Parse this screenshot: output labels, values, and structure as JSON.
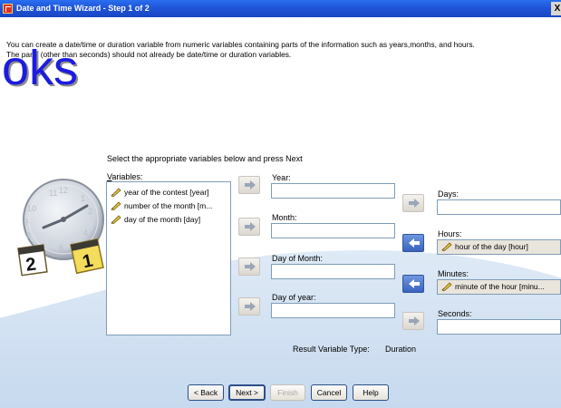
{
  "window": {
    "title": "Date and Time Wizard - Step 1 of 2",
    "close_glyph": "X"
  },
  "intro": {
    "line1": "You can create a date/time or duration variable from numeric variables containing parts of the information such as years,months, and hours.",
    "line2": "The parts (other than seconds) should not already be date/time or duration variables."
  },
  "watermark": "oks",
  "clock_card_digits": [
    "2",
    "1"
  ],
  "instruction": "Select the appropriate variables below and press Next",
  "variables": {
    "label": "Variables:",
    "items": [
      "year of the contest [year]",
      "number of the month [m...",
      "day of the month [day]"
    ]
  },
  "left_fields": [
    {
      "label": "Year:",
      "value": ""
    },
    {
      "label": "Month:",
      "value": ""
    },
    {
      "label": "Day of Month:",
      "value": ""
    },
    {
      "label": "Day of year:",
      "value": ""
    }
  ],
  "right_fields": [
    {
      "label": "Days:",
      "value": ""
    },
    {
      "label": "Hours:",
      "value": "hour of the day [hour]"
    },
    {
      "label": "Minutes:",
      "value": "minute of the hour [minu..."
    },
    {
      "label": "Seconds:",
      "value": ""
    }
  ],
  "result": {
    "label": "Result Variable Type:",
    "value": "Duration"
  },
  "buttons": {
    "back": "< Back",
    "next": "Next >",
    "finish": "Finish",
    "cancel": "Cancel",
    "help": "Help"
  },
  "colors": {
    "titlebar": "#1f54d8",
    "accent_blue": "#3a63bf",
    "watermark": "#1c1ce0"
  }
}
